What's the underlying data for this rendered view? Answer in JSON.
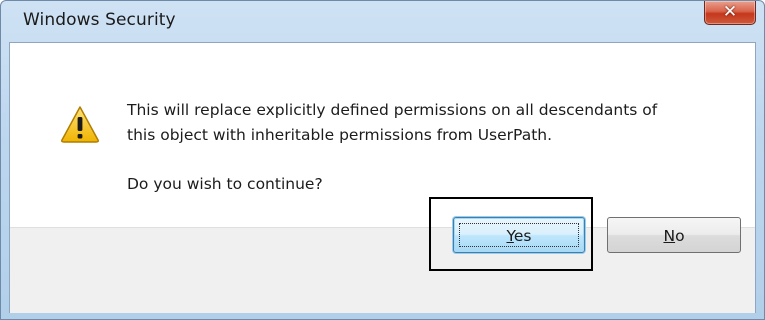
{
  "window": {
    "title": "Windows Security",
    "close_glyph": "✕"
  },
  "dialog": {
    "icon": "warning-icon",
    "message_line1": "This will replace explicitly defined permissions on all descendants of",
    "message_line2": "this object with inheritable permissions from UserPath.",
    "question": "Do you wish to continue?"
  },
  "buttons": {
    "yes": {
      "mnemonic": "Y",
      "rest": "es"
    },
    "no": {
      "mnemonic": "N",
      "rest": "o"
    }
  },
  "colors": {
    "warning_fill": "#f5c400",
    "close_red": "#c4371d",
    "focus_blue": "#3c7fb1"
  }
}
